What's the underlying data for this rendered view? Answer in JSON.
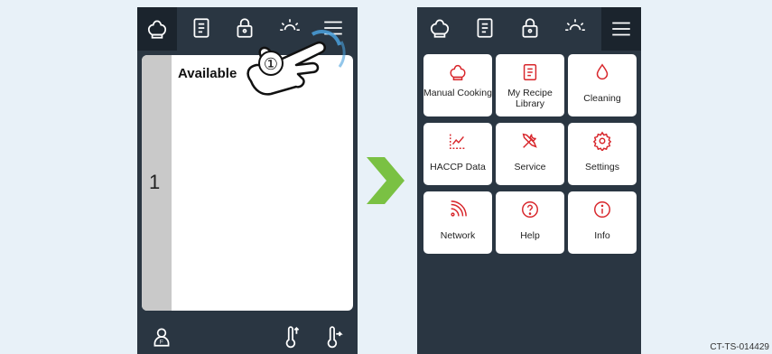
{
  "left_screen": {
    "slot": {
      "number": "1",
      "status": "Available"
    },
    "step_marker": "①"
  },
  "right_screen": {
    "menu_tiles": [
      {
        "label": "Manual Cooking",
        "icon": "chef-hat-icon"
      },
      {
        "label": "My Recipe Library",
        "icon": "recipe-book-icon"
      },
      {
        "label": "Cleaning",
        "icon": "water-drop-icon"
      },
      {
        "label": "HACCP Data",
        "icon": "line-chart-icon"
      },
      {
        "label": "Service",
        "icon": "tools-icon"
      },
      {
        "label": "Settings",
        "icon": "gear-icon"
      },
      {
        "label": "Network",
        "icon": "wifi-icon"
      },
      {
        "label": "Help",
        "icon": "question-icon"
      },
      {
        "label": "Info",
        "icon": "info-icon"
      }
    ]
  },
  "toolbar_icons": [
    "chef-hat-icon",
    "recipe-book-icon",
    "lock-icon",
    "brightness-icon",
    "menu-icon"
  ],
  "colors": {
    "panel": "#2a3642",
    "accent_red": "#d8262b",
    "arrow_green": "#7ac143"
  },
  "document_code": "CT-TS-014429"
}
